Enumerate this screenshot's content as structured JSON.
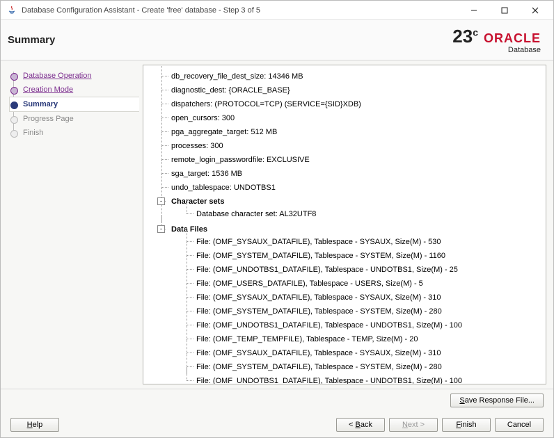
{
  "title": "Database Configuration Assistant - Create 'free' database - Step 3 of 5",
  "header": {
    "title": "Summary"
  },
  "brand": {
    "version": "23",
    "sup": "c",
    "name": "ORACLE",
    "sub": "Database"
  },
  "steps": [
    {
      "label": "Database Operation",
      "state": "done"
    },
    {
      "label": "Creation Mode",
      "state": "done"
    },
    {
      "label": "Summary",
      "state": "current"
    },
    {
      "label": "Progress Page",
      "state": "future"
    },
    {
      "label": "Finish",
      "state": "future"
    }
  ],
  "tree": {
    "params": [
      "db_recovery_file_dest_size: 14346 MB",
      "diagnostic_dest: {ORACLE_BASE}",
      "dispatchers: (PROTOCOL=TCP) (SERVICE={SID}XDB)",
      "open_cursors: 300",
      "pga_aggregate_target: 512 MB",
      "processes: 300",
      "remote_login_passwordfile: EXCLUSIVE",
      "sga_target: 1536 MB",
      "undo_tablespace: UNDOTBS1"
    ],
    "charsets_label": "Character sets",
    "charsets": [
      "Database character set: AL32UTF8"
    ],
    "datafiles_label": "Data Files",
    "datafiles": [
      "File: (OMF_SYSAUX_DATAFILE), Tablespace - SYSAUX, Size(M) - 530",
      "File: (OMF_SYSTEM_DATAFILE), Tablespace - SYSTEM, Size(M) - 1160",
      "File: (OMF_UNDOTBS1_DATAFILE), Tablespace - UNDOTBS1, Size(M) - 25",
      "File: (OMF_USERS_DATAFILE), Tablespace - USERS, Size(M) - 5",
      "File: (OMF_SYSAUX_DATAFILE), Tablespace - SYSAUX, Size(M) - 310",
      "File: (OMF_SYSTEM_DATAFILE), Tablespace - SYSTEM, Size(M) - 280",
      "File: (OMF_UNDOTBS1_DATAFILE), Tablespace - UNDOTBS1, Size(M) - 100",
      "File: (OMF_TEMP_TEMPFILE), Tablespace - TEMP, Size(M) - 20",
      "File: (OMF_SYSAUX_DATAFILE), Tablespace - SYSAUX, Size(M) - 310",
      "File: (OMF_SYSTEM_DATAFILE), Tablespace - SYSTEM, Size(M) - 280",
      "File: (OMF_UNDOTBS1_DATAFILE), Tablespace - UNDOTBS1, Size(M) - 100"
    ]
  },
  "buttons": {
    "save_response": "Save Response File...",
    "help": "Help",
    "back": "< Back",
    "next": "Next >",
    "finish": "Finish",
    "cancel": "Cancel"
  }
}
